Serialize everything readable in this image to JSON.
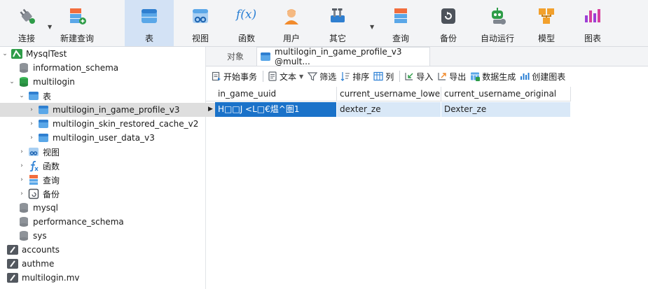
{
  "toolbar": {
    "items": [
      {
        "label": "连接"
      },
      {
        "label": "新建查询"
      },
      {
        "label": "表"
      },
      {
        "label": "视图"
      },
      {
        "label": "函数"
      },
      {
        "label": "用户"
      },
      {
        "label": "其它"
      },
      {
        "label": "查询"
      },
      {
        "label": "备份"
      },
      {
        "label": "自动运行"
      },
      {
        "label": "模型"
      },
      {
        "label": "图表"
      }
    ],
    "function_glyph": "f(x)",
    "table_glyph": "OO"
  },
  "sidebar": {
    "connection": "MysqlTest",
    "items": [
      {
        "label": "information_schema"
      },
      {
        "label": "multilogin"
      },
      {
        "label": "表"
      },
      {
        "label": "multilogin_in_game_profile_v3"
      },
      {
        "label": "multilogin_skin_restored_cache_v2"
      },
      {
        "label": "multilogin_user_data_v3"
      },
      {
        "label": "视图"
      },
      {
        "label": "函数"
      },
      {
        "label": "查询"
      },
      {
        "label": "备份"
      },
      {
        "label": "mysql"
      },
      {
        "label": "performance_schema"
      },
      {
        "label": "sys"
      },
      {
        "label": "accounts"
      },
      {
        "label": "authme"
      },
      {
        "label": "multilogin.mv"
      }
    ]
  },
  "tabs": {
    "objects": "对象",
    "active": "multilogin_in_game_profile_v3 @mult..."
  },
  "data_toolbar": {
    "begin_transaction": "开始事务",
    "text": "文本",
    "filter": "筛选",
    "sort": "排序",
    "columns": "列",
    "import": "导入",
    "export": "导出",
    "data_generation": "数据生成",
    "create_chart": "创建图表"
  },
  "grid": {
    "columns": [
      "in_game_uuid",
      "current_username_lower",
      "current_username_original"
    ],
    "rows": [
      [
        "H□□J <L□€煴^圏1",
        "dexter_ze",
        "Dexter_ze"
      ]
    ]
  },
  "colors": {
    "selection": "#1a72c9",
    "row_highlight": "#d9e8f7",
    "toolbar_active": "#d3e2f5"
  }
}
